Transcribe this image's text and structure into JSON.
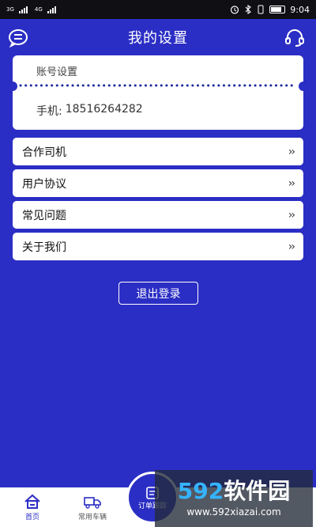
{
  "status_bar": {
    "network_left": "3G",
    "network_right": "4G",
    "time": "9:04"
  },
  "header": {
    "title": "我的设置",
    "left_icon": "chat-icon",
    "right_icon": "headset-icon"
  },
  "account": {
    "title": "账号设置",
    "phone_label": "手机:",
    "phone_value": "18516264282"
  },
  "menu": [
    {
      "label": "合作司机"
    },
    {
      "label": "用户协议"
    },
    {
      "label": "常见问题"
    },
    {
      "label": "关于我们"
    }
  ],
  "logout_label": "退出登录",
  "bottom_nav": {
    "home_label": "首页",
    "vehicles_label": "常用车辆",
    "float_label": "订单跟踪"
  },
  "watermark": {
    "number": "592",
    "text": "软件园",
    "url": "www.592xiazai.com"
  },
  "colors": {
    "background": "#2b2ec4",
    "card": "#ffffff",
    "watermark_accent": "#35b3ff"
  }
}
